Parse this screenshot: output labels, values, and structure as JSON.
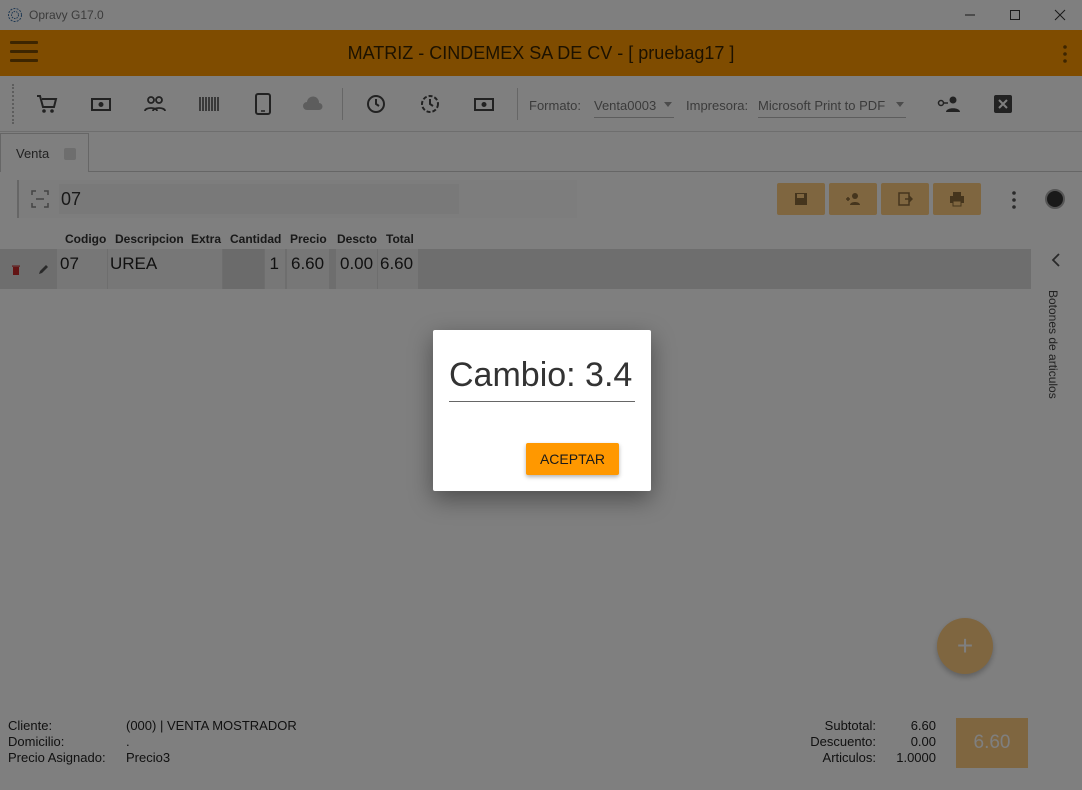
{
  "window": {
    "title": "Opravy G17.0"
  },
  "header": {
    "title": "MATRIZ - CINDEMEX SA DE CV - [ pruebag17 ]"
  },
  "toolbar": {
    "formato_label": "Formato:",
    "formato_value": "Venta0003",
    "impresora_label": "Impresora:",
    "impresora_value": "Microsoft Print to PDF"
  },
  "tabs": [
    {
      "label": "Venta"
    }
  ],
  "search": {
    "value": "07"
  },
  "columns": [
    "Codigo",
    "Descripcion",
    "Extra",
    "Cantidad",
    "Precio",
    "Descto",
    "Total"
  ],
  "rows": [
    {
      "codigo": "07",
      "descripcion": "UREA",
      "extra": "",
      "cantidad": "1",
      "precio": "6.60",
      "descto": "0.00",
      "total": "6.60"
    }
  ],
  "side_panel": {
    "label": "Botones de articulos"
  },
  "fab": {
    "label": "+"
  },
  "footer": {
    "cliente_label": "Cliente:",
    "cliente_value": "(000) | VENTA MOSTRADOR",
    "domicilio_label": "Domicilio:",
    "domicilio_value": ".",
    "precio_label": "Precio Asignado:",
    "precio_value": "Precio3",
    "subtotal_label": "Subtotal:",
    "subtotal_value": "6.60",
    "descuento_label": "Descuento:",
    "descuento_value": "0.00",
    "articulos_label": "Articulos:",
    "articulos_value": "1.0000",
    "total_button": "6.60"
  },
  "dialog": {
    "text": "Cambio: 3.4",
    "accept_label": "ACEPTAR"
  },
  "colors": {
    "accent": "#ff9800",
    "accent_light": "#ffcc80"
  }
}
